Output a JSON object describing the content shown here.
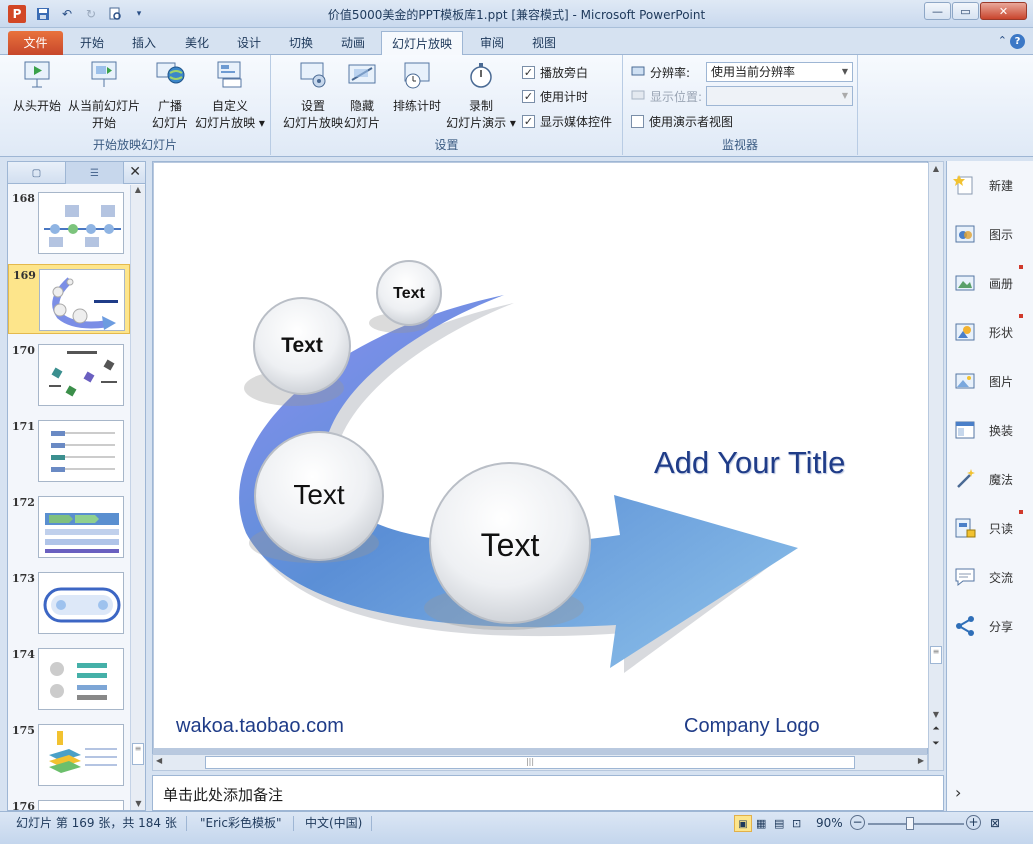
{
  "window": {
    "app_icon": "P",
    "title": "价值5000美金的PPT模板库1.ppt [兼容模式] - Microsoft PowerPoint"
  },
  "tabs": [
    {
      "label": "文件"
    },
    {
      "label": "开始"
    },
    {
      "label": "插入"
    },
    {
      "label": "美化"
    },
    {
      "label": "设计"
    },
    {
      "label": "切换"
    },
    {
      "label": "动画"
    },
    {
      "label": "幻灯片放映"
    },
    {
      "label": "审阅"
    },
    {
      "label": "视图"
    }
  ],
  "ribbon": {
    "group_start": {
      "label": "开始放映幻灯片",
      "from_start": "从头开始",
      "from_current_1": "从当前幻灯片",
      "from_current_2": "开始",
      "broadcast_1": "广播",
      "broadcast_2": "幻灯片",
      "custom_1": "自定义",
      "custom_2": "幻灯片放映"
    },
    "group_setup": {
      "label": "设置",
      "setup_1": "设置",
      "setup_2": "幻灯片放映",
      "hide_1": "隐藏",
      "hide_2": "幻灯片",
      "rehearse": "排练计时",
      "record_1": "录制",
      "record_2": "幻灯片演示",
      "play_narrations": "播放旁白",
      "use_timings": "使用计时",
      "show_media_controls": "显示媒体控件"
    },
    "group_monitors": {
      "label": "监视器",
      "resolution_label": "分辨率:",
      "resolution_value": "使用当前分辨率",
      "show_on_label": "显示位置:",
      "presenter_view": "使用演示者视图"
    }
  },
  "thumbnails": [
    {
      "num": "168"
    },
    {
      "num": "169"
    },
    {
      "num": "170"
    },
    {
      "num": "171"
    },
    {
      "num": "172"
    },
    {
      "num": "173"
    },
    {
      "num": "174"
    },
    {
      "num": "175"
    },
    {
      "num": "176"
    }
  ],
  "slide": {
    "bubble_small": "Text",
    "bubble_medium": "Text",
    "bubble_large1": "Text",
    "bubble_large2": "Text",
    "title": "Add Your Title",
    "website": "wakoa.taobao.com",
    "logo": "Company Logo"
  },
  "notes_placeholder": "单击此处添加备注",
  "right_panel": [
    {
      "label": "新建",
      "icon": "new-icon"
    },
    {
      "label": "图示",
      "icon": "diagram-icon"
    },
    {
      "label": "画册",
      "icon": "album-icon"
    },
    {
      "label": "形状",
      "icon": "shape-icon"
    },
    {
      "label": "图片",
      "icon": "picture-icon"
    },
    {
      "label": "换装",
      "icon": "layout-icon"
    },
    {
      "label": "魔法",
      "icon": "magic-icon"
    },
    {
      "label": "只读",
      "icon": "readonly-icon"
    },
    {
      "label": "交流",
      "icon": "chat-icon"
    },
    {
      "label": "分享",
      "icon": "share-icon"
    }
  ],
  "status": {
    "slide_info": "幻灯片 第 169 张，共 184 张",
    "theme": "\"Eric彩色模板\"",
    "language": "中文(中国)",
    "zoom": "90%"
  },
  "colors": {
    "accent_file_tab": "#d24726",
    "title_text": "#1f3c88",
    "arrow_blue": "#5b8fd6",
    "selected_thumb": "#fde58b"
  }
}
